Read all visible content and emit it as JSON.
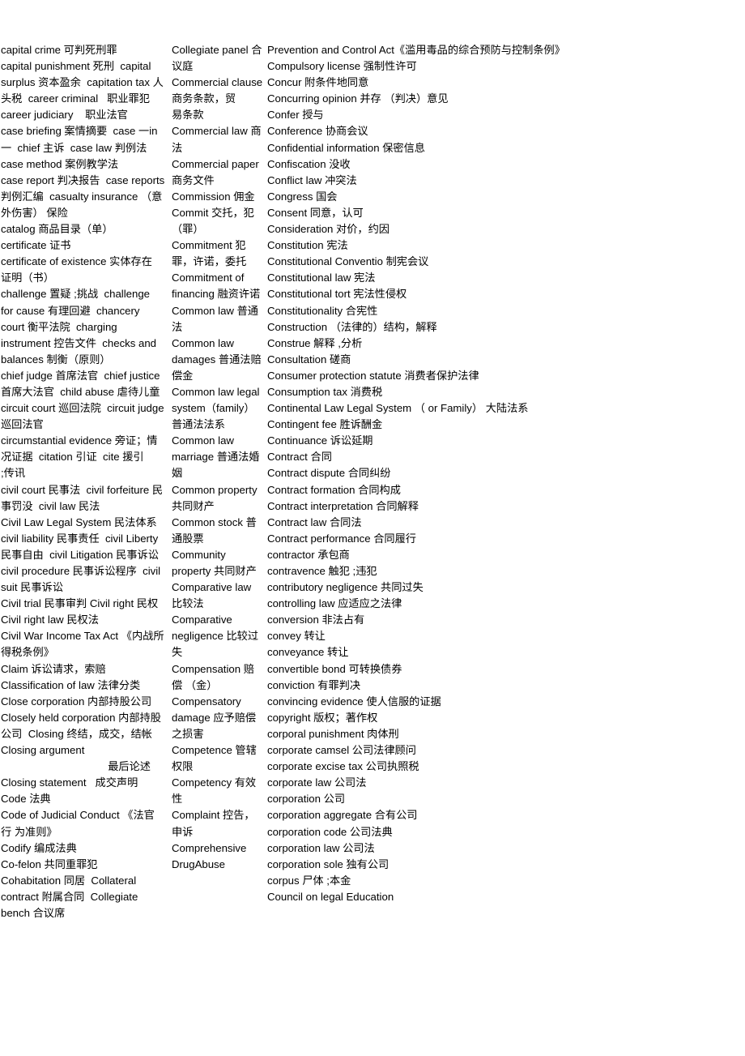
{
  "document": {
    "type": "bilingual-legal-glossary",
    "language_pair": "English-Chinese",
    "columns": [
      {
        "id": "column-left",
        "entries": [
          "capital crime 可判死刑罪",
          "capital punishment 死刑  capital surplus 资本盈余  capitation tax 人头税  career criminal   职业罪犯",
          "career judiciary    职业法官",
          "case briefing 案情摘要  case 一in一  chief 主诉  case law 判例法  case method 案例教学法",
          "case report 判决报告  case reports 判例汇编  casualty insurance （意外伤害） 保险",
          "catalog 商品目录（单）",
          "certificate 证书",
          "certificate of existence 实体存在  证明（书）",
          "challenge 置疑 ;挑战  challenge for cause 有理回避  chancery court 衡平法院  charging instrument 控告文件  checks and balances 制衡（原则）",
          "chief judge 首席法官  chief justice 首席大法官  child abuse 虐待儿童  circuit court 巡回法院  circuit judge 巡回法官",
          "circumstantial evidence 旁证；情 况证据  citation 引证  cite 援引        ;传讯",
          "civil court 民事法  civil forfeiture 民事罚没  civil law 民法",
          "Civil Law Legal System 民法体系  civil liability 民事责任  civil Liberty 民事自由  civil Litigation 民事诉讼  civil procedure 民事诉讼程序  civil suit 民事诉讼",
          "Civil trial 民事审判 Civil right 民权",
          "Civil right law 民权法",
          "Civil War Income Tax Act 《内战所 得税条例》",
          "Claim 诉讼请求，索赔",
          "Classification of law 法律分类",
          "Close corporation 内部持股公司  Closely held corporation 内部持股 公司  Closing 终结，成交，结帐  Closing argument",
          "最后论述",
          "Closing statement   成交声明",
          "Code 法典",
          "Code of Judicial Conduct 《法官行 为准则》",
          "Codify 编成法典",
          "Co-felon 共同重罪犯",
          "Cohabitation 同居  Collateral contract 附属合同  Collegiate bench 合议席"
        ],
        "indented_entry_indexes": [
          19
        ]
      },
      {
        "id": "column-middle",
        "entries": [
          "Collegiate panel 合议庭",
          "Commercial clause 商务条款，贸",
          "易条款",
          "Commercial law 商法",
          "Commercial paper 商务文件",
          "Commission 佣金",
          "Commit 交托，犯（罪）",
          "Commitment 犯罪，许诺，委托",
          "Commitment of financing 融资许诺",
          "Common law 普通法",
          "Common law damages 普通法赔",
          "偿金",
          "Common law legal system（family）",
          "普通法法系",
          "Common law marriage 普通法婚姻",
          "Common property 共同财产",
          "Common stock 普通股票",
          "Community property 共同财产",
          "Comparative law 比较法",
          "Comparative negligence 比较过失",
          "Compensation 赔偿 （金）",
          "Compensatory damage 应予赔偿",
          "之损害",
          "Competence 管辖权限",
          "Competency 有效性",
          "Complaint 控告，申诉",
          "Comprehensive DrugAbuse"
        ],
        "indented_entry_indexes": []
      },
      {
        "id": "column-right",
        "entries": [
          "Prevention and Control Act《滥用毒品的综合预防与控制条例》",
          "Compulsory license 强制性许可",
          "Concur 附条件地同意",
          "Concurring opinion 并存 （判决）意见",
          "Confer 授与",
          "Conference 协商会议",
          "Confidential information 保密信息",
          "Confiscation 没收",
          "Conflict law 冲突法",
          "Congress 国会",
          "Consent 同意，认可",
          "Consideration 对价，约因",
          "Constitution 宪法",
          "Constitutional Conventio 制宪会议",
          "Constitutional law 宪法",
          "Constitutional tort 宪法性侵权",
          "Constitutionality 合宪性",
          "Construction （法律的）结构，解释",
          "Construe 解释 ,分析",
          "Consultation 磋商",
          "Consumer protection statute 消费者保护法律",
          "Consumption tax 消费税",
          "Continental Law Legal System （ or Family） 大陆法系",
          "Contingent fee 胜诉酬金",
          "Continuance 诉讼延期",
          "Contract 合同",
          "Contract dispute 合同纠纷",
          "Contract formation 合同构成",
          "Contract interpretation 合同解释",
          "Contract law 合同法",
          "Contract performance 合同履行",
          "contractor 承包商",
          "contravence 触犯 ;违犯",
          "contributory negligence 共同过失",
          "controlling law 应适应之法律",
          "conversion 非法占有",
          "convey 转让",
          "conveyance 转让",
          "convertible bond 可转换债券",
          "conviction 有罪判决",
          "convincing evidence 使人信服的证据",
          "copyright 版权；著作权",
          "corporal punishment 肉体刑",
          "corporate camsel 公司法律顾问",
          "corporate excise tax 公司执照税",
          "corporate law 公司法",
          "corporation 公司",
          "corporation aggregate 合有公司",
          "corporation code 公司法典",
          "corporation law 公司法",
          "corporation sole 独有公司",
          "corpus 尸体 ;本金",
          "Council on legal Education"
        ],
        "indented_entry_indexes": []
      }
    ]
  }
}
